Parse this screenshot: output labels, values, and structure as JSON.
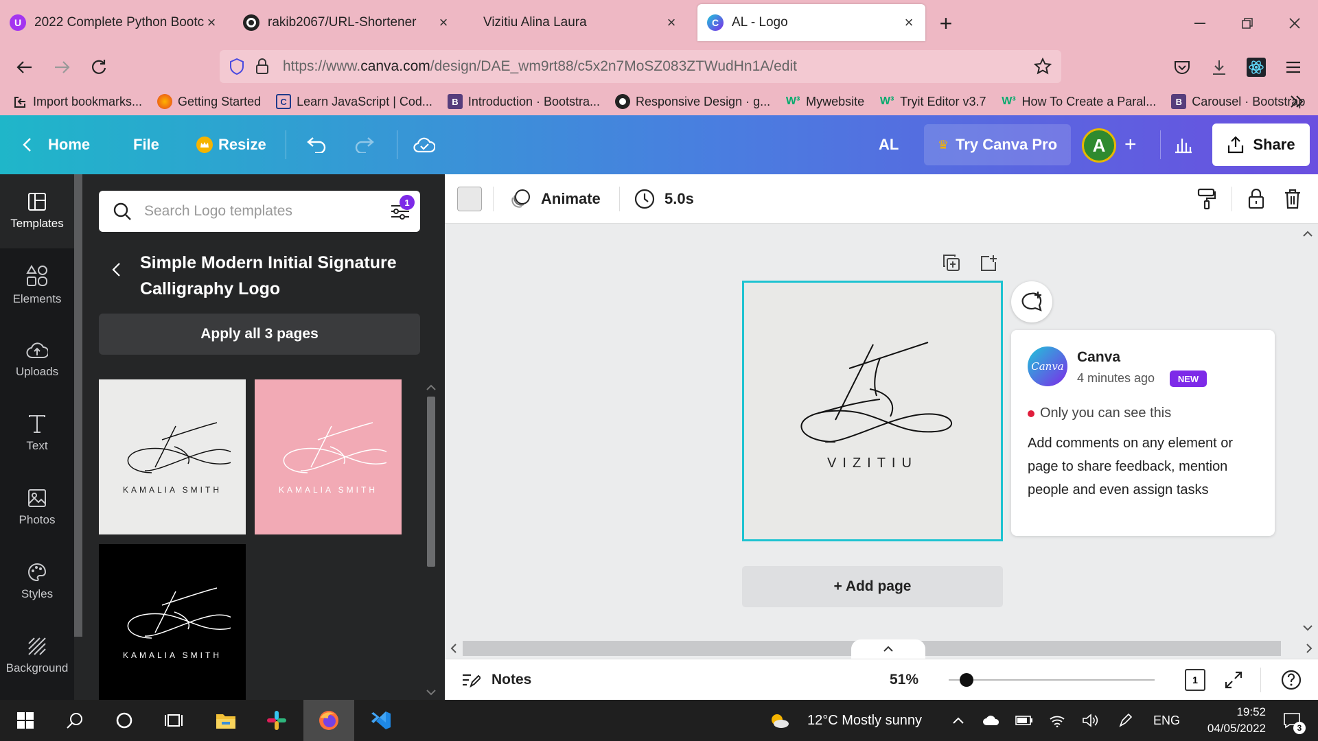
{
  "browser": {
    "tabs": [
      {
        "title": "2022 Complete Python Bootcamp",
        "active": false
      },
      {
        "title": "rakib2067/URL-Shortener",
        "active": false
      },
      {
        "title": "Vizitiu Alina Laura",
        "active": false
      },
      {
        "title": "AL - Logo",
        "active": true
      }
    ],
    "url": {
      "prefix": "https://www.",
      "domain": "canva.com",
      "path": "/design/DAE_wm9rt88/c5x2n7MoSZ083ZTWudHn1A/edit"
    },
    "bookmarks": [
      "Import bookmarks...",
      "Getting Started",
      "Learn JavaScript | Cod...",
      "Introduction · Bootstra...",
      "Responsive Design · g...",
      "Mywebsite",
      "Tryit Editor v3.7",
      "How To Create a Paral...",
      "Carousel · Bootstrap"
    ]
  },
  "canva": {
    "header": {
      "home": "Home",
      "file": "File",
      "resize": "Resize",
      "initials": "AL",
      "try_pro": "Try Canva Pro",
      "avatar": "A",
      "share": "Share"
    },
    "rail": [
      "Templates",
      "Elements",
      "Uploads",
      "Text",
      "Photos",
      "Styles",
      "Background"
    ],
    "panel": {
      "search_placeholder": "Search Logo templates",
      "filter_count": "1",
      "template_title": "Simple Modern Initial Signature Calligraphy Logo",
      "apply_button": "Apply all 3 pages",
      "thumbnails": [
        {
          "name": "KAMALIA SMITH",
          "bg": "#ebebea"
        },
        {
          "name": "KAMALIA SMITH",
          "bg": "#f2aab5"
        },
        {
          "name": "KAMALIA SMITH",
          "bg": "#000000"
        }
      ]
    },
    "toolbar": {
      "animate": "Animate",
      "duration": "5.0s"
    },
    "page": {
      "logo_name": "VIZITIU",
      "add_page": "+ Add page"
    },
    "comment": {
      "author": "Canva",
      "logo_text": "Canva",
      "time": "4 minutes ago",
      "badge": "NEW",
      "privacy": "Only you can see this",
      "body": "Add comments on any element or page to share feedback, mention people and even assign tasks"
    },
    "footer": {
      "notes": "Notes",
      "zoom": "51%",
      "page_count": "1"
    }
  },
  "taskbar": {
    "weather": "12°C  Mostly sunny",
    "language": "ENG",
    "time": "19:52",
    "date": "04/05/2022",
    "notifications": "3"
  },
  "colors": {
    "accent": "#1ec3d1",
    "purple": "#7d2ae8",
    "tab_bar": "#eeb8c4"
  }
}
